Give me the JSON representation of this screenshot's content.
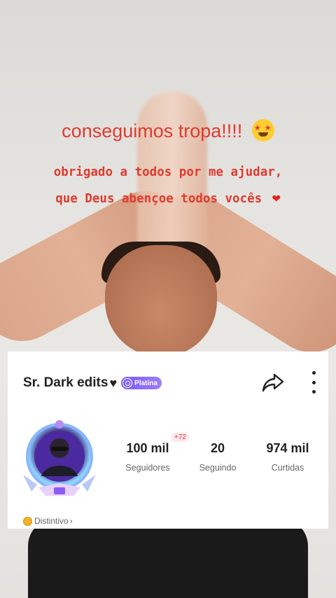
{
  "overlay": {
    "line1": "conseguimos tropa!!!!",
    "line2": "obrigado a todos por me ajudar,",
    "line3": "que Deus abençoe todos vocês"
  },
  "profile": {
    "name": "Sr. Dark edits",
    "badge_label": "Platina",
    "distintivo_label": "Distintivo",
    "stats": {
      "followers": {
        "value": "100 mil",
        "label": "Seguidores",
        "delta": "+72"
      },
      "following": {
        "value": "20",
        "label": "Seguindo"
      },
      "likes": {
        "value": "974 mil",
        "label": "Curtidas"
      }
    }
  },
  "colors": {
    "caption_red": "#e03a2f",
    "badge_purple": "#7b5cf5",
    "delta_pink": "#e8334a"
  },
  "icons": [
    "star-struck-emoji-icon",
    "red-heart-icon",
    "black-heart-icon",
    "share-icon",
    "more-options-icon",
    "coin-icon",
    "chevron-right-icon"
  ]
}
